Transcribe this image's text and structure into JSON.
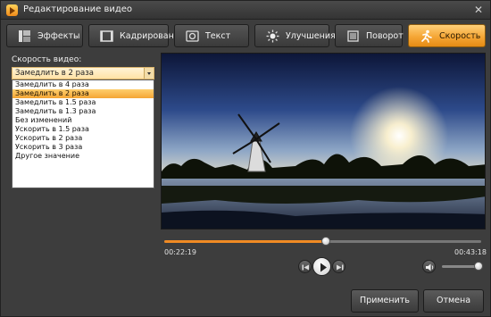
{
  "window": {
    "title": "Редактирование видео",
    "close_glyph": "✕"
  },
  "tabs": [
    {
      "label": "Эффекты",
      "icon": "effects-icon",
      "active": false
    },
    {
      "label": "Кадрирование",
      "icon": "crop-icon",
      "active": false
    },
    {
      "label": "Текст",
      "icon": "text-icon",
      "active": false
    },
    {
      "label": "Улучшения",
      "icon": "enhance-icon",
      "active": false
    },
    {
      "label": "Поворот",
      "icon": "rotate-icon",
      "active": false
    },
    {
      "label": "Скорость",
      "icon": "speed-icon",
      "active": true
    }
  ],
  "speed": {
    "label": "Скорость видео:",
    "selected": "Замедлить в 2 раза",
    "options": [
      "Замедлить в 4 раза",
      "Замедлить в 2 раза",
      "Замедлить в 1.5 раза",
      "Замедлить в 1.3 раза",
      "Без изменений",
      "Ускорить в 1.5 раза",
      "Ускорить в 2 раза",
      "Ускорить в 3 раза",
      "Другое значение"
    ],
    "highlighted_index": 1
  },
  "player": {
    "current_time": "00:22:19",
    "total_time": "00:43:18",
    "progress": 0.51,
    "volume": 0.85
  },
  "buttons": {
    "apply": "Применить",
    "cancel": "Отмена"
  },
  "colors": {
    "accent": "#f5a636",
    "progress": "#f08a24"
  }
}
